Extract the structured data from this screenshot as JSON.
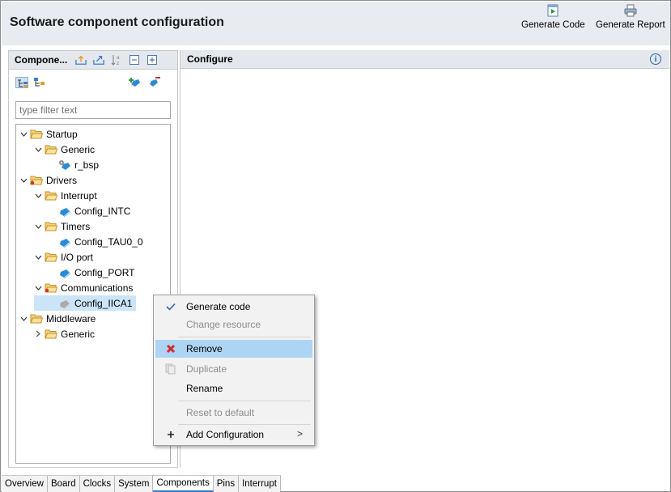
{
  "header": {
    "title": "Software component configuration",
    "generate_code": "Generate Code",
    "generate_report": "Generate Report"
  },
  "components_panel": {
    "title": "Compone...",
    "filter_placeholder": "type filter text"
  },
  "tree": [
    {
      "label": "Startup"
    },
    {
      "label": "Generic"
    },
    {
      "label": "r_bsp"
    },
    {
      "label": "Drivers"
    },
    {
      "label": "Interrupt"
    },
    {
      "label": "Config_INTC"
    },
    {
      "label": "Timers"
    },
    {
      "label": "Config_TAU0_0"
    },
    {
      "label": "I/O port"
    },
    {
      "label": "Config_PORT"
    },
    {
      "label": "Communications"
    },
    {
      "label": "Config_IICA1"
    },
    {
      "label": "Middleware"
    },
    {
      "label": "Generic"
    }
  ],
  "configure_panel": {
    "title": "Configure"
  },
  "context_menu": {
    "items": [
      {
        "label": "Generate code"
      },
      {
        "label": "Change resource"
      },
      {
        "label": "Remove"
      },
      {
        "label": "Duplicate"
      },
      {
        "label": "Rename"
      },
      {
        "label": "Reset to default"
      },
      {
        "label": "Add Configuration"
      }
    ],
    "submenu_arrow": ">"
  },
  "tabs": [
    {
      "label": "Overview"
    },
    {
      "label": "Board"
    },
    {
      "label": "Clocks"
    },
    {
      "label": "System"
    },
    {
      "label": "Components"
    },
    {
      "label": "Pins"
    },
    {
      "label": "Interrupt"
    }
  ],
  "colors": {
    "header_bg": "#e8ebef",
    "selection": "#cce4f7",
    "menu_highlight": "#add4f2",
    "folder": "#e8a83a",
    "component": "#2a8ad4"
  }
}
